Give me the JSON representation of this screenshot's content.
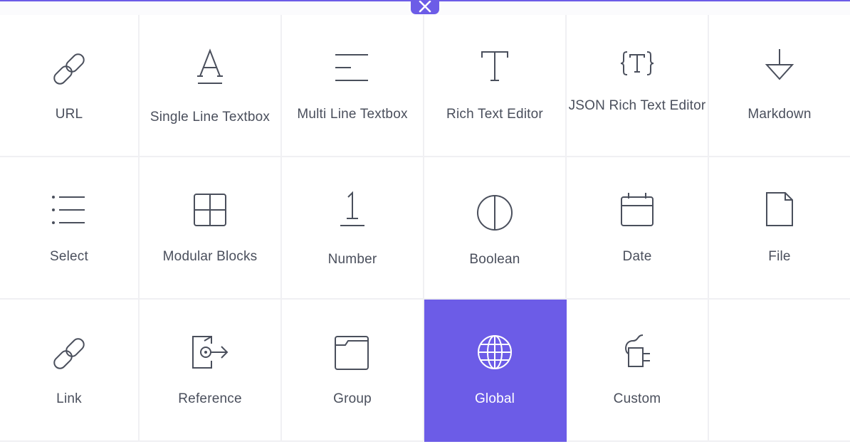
{
  "close_button": {
    "icon": "close-icon"
  },
  "fields": [
    {
      "id": "url",
      "label": "URL",
      "icon": "link-icon",
      "selected": false
    },
    {
      "id": "single-line-textbox",
      "label": "Single Line Textbox",
      "icon": "letter-a-underline-icon",
      "selected": false
    },
    {
      "id": "multi-line-textbox",
      "label": "Multi Line Textbox",
      "icon": "multi-line-icon",
      "selected": false
    },
    {
      "id": "rich-text-editor",
      "label": "Rich Text Editor",
      "icon": "letter-t-icon",
      "selected": false
    },
    {
      "id": "json-rich-text-editor",
      "label": "JSON Rich Text Editor",
      "icon": "braces-t-icon",
      "selected": false
    },
    {
      "id": "markdown",
      "label": "Markdown",
      "icon": "arrow-down-icon",
      "selected": false
    },
    {
      "id": "select",
      "label": "Select",
      "icon": "list-icon",
      "selected": false
    },
    {
      "id": "modular-blocks",
      "label": "Modular Blocks",
      "icon": "grid-blocks-icon",
      "selected": false
    },
    {
      "id": "number",
      "label": "Number",
      "icon": "number-one-icon",
      "selected": false
    },
    {
      "id": "boolean",
      "label": "Boolean",
      "icon": "half-circle-icon",
      "selected": false
    },
    {
      "id": "date",
      "label": "Date",
      "icon": "calendar-icon",
      "selected": false
    },
    {
      "id": "file",
      "label": "File",
      "icon": "file-icon",
      "selected": false
    },
    {
      "id": "link",
      "label": "Link",
      "icon": "link-icon",
      "selected": false
    },
    {
      "id": "reference",
      "label": "Reference",
      "icon": "reference-icon",
      "selected": false
    },
    {
      "id": "group",
      "label": "Group",
      "icon": "folder-icon",
      "selected": false
    },
    {
      "id": "global",
      "label": "Global",
      "icon": "globe-icon",
      "selected": true
    },
    {
      "id": "custom",
      "label": "Custom",
      "icon": "plug-icon",
      "selected": false
    }
  ],
  "colors": {
    "accent": "#6c5ce7",
    "text": "#4a4f5c",
    "icon_stroke": "#4a4f5c",
    "grid_line": "#f0f0f3",
    "selected_text": "#ffffff"
  }
}
